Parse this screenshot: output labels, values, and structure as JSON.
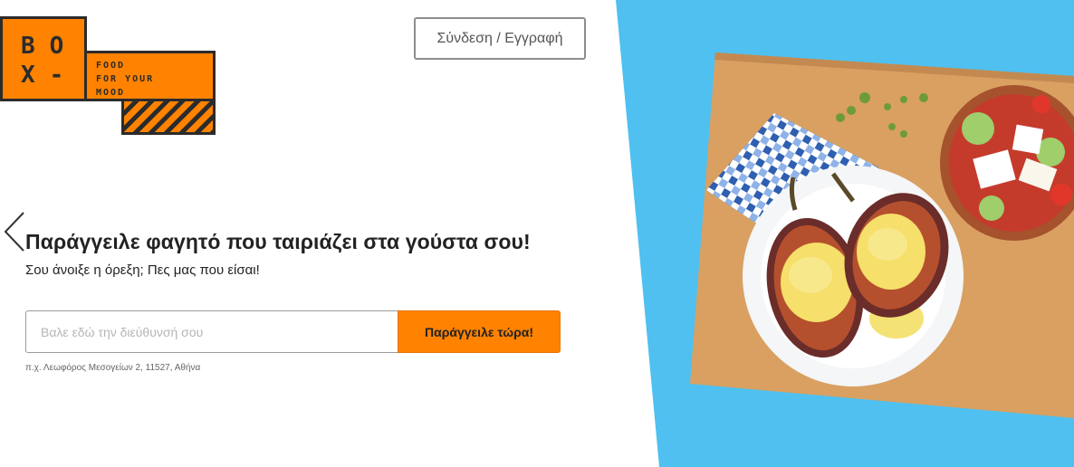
{
  "logo": {
    "letters_line1": "BO",
    "letters_line2": "X-",
    "tagline": [
      "FOOD",
      "FOR YOUR",
      "MOOD"
    ],
    "colors": {
      "brand": "#ff8200",
      "dark": "#2b2b2b"
    }
  },
  "header": {
    "login_label": "Σύνδεση / Εγγραφή"
  },
  "hero": {
    "headline": "Παράγγειλε φαγητό που ταιριάζει στα γούστα σου!",
    "subtitle": "Σου άνοιξε η όρεξη; Πες μας που είσαι!",
    "address_placeholder": "Βαλε εδώ την διεύθυνσή σου",
    "address_value": "",
    "order_button": "Παράγγειλε τώρα!",
    "example": "π.χ. Λεωφόρος Μεσογείων 2, 11527, Αθήνα",
    "back_icon": "chevron-left-icon"
  },
  "image": {
    "subject": "food-plate",
    "colors": {
      "background": "#4fc0f0",
      "board": "#d9a062",
      "accent": "#ff8200"
    }
  }
}
